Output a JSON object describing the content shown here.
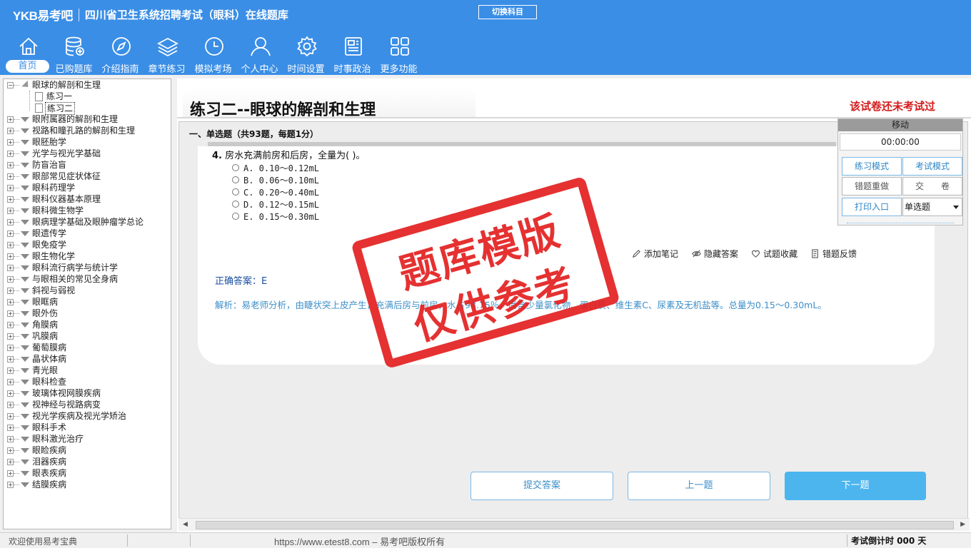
{
  "header": {
    "logo": "YKB易考吧",
    "title": "四川省卫生系统招聘考试（眼科）在线题库",
    "switch_label": "切换科目",
    "nav": [
      {
        "label": "首页",
        "icon": "home-icon",
        "active": true
      },
      {
        "label": "已购题库",
        "icon": "database-icon"
      },
      {
        "label": "介绍指南",
        "icon": "compass-icon"
      },
      {
        "label": "章节练习",
        "icon": "layers-icon"
      },
      {
        "label": "模拟考场",
        "icon": "clock-icon"
      },
      {
        "label": "个人中心",
        "icon": "user-icon"
      },
      {
        "label": "时间设置",
        "icon": "gear-icon"
      },
      {
        "label": "时事政治",
        "icon": "news-icon"
      },
      {
        "label": "更多功能",
        "icon": "grid-icon"
      }
    ]
  },
  "sidebar": {
    "root": "眼球的解剖和生理",
    "children": [
      "练习一",
      "练习二"
    ],
    "items": [
      "眼附属器的解剖和生理",
      "视路和瞳孔路的解剖和生理",
      "眼胚胎学",
      "光学与视光学基础",
      "防盲治盲",
      "眼部常见症状体征",
      "眼科药理学",
      "眼科仪器基本原理",
      "眼科微生物学",
      "眼病理学基础及眼肿瘤学总论",
      "眼遗传学",
      "眼免疫学",
      "眼生物化学",
      "眼科流行病学与统计学",
      "与眼相关的常见全身病",
      "斜视与弱视",
      "眼眶病",
      "眼外伤",
      "角膜病",
      "巩膜病",
      "葡萄膜病",
      "晶状体病",
      "青光眼",
      "眼科检查",
      "玻璃体视网膜疾病",
      "视神经与视路病变",
      "视光学疾病及视光学矫治",
      "眼科手术",
      "眼科激光治疗",
      "眼睑疾病",
      "泪器疾病",
      "眼表疾病",
      "结膜疾病"
    ]
  },
  "main": {
    "exam_title": "练习二--眼球的解剖和生理",
    "status": "该试卷还未考试过",
    "section": "一、单选题（共93题，每题1分）",
    "question_number": "4.",
    "question_text": "房水充满前房和后房，全量为( )。",
    "options": [
      "A. 0.10～0.12mL",
      "B. 0.06～0.10mL",
      "C. 0.20～0.40mL",
      "D. 0.12～0.15mL",
      "E. 0.15～0.30mL"
    ],
    "tools": [
      {
        "label": "添加笔记",
        "icon": "pencil-icon"
      },
      {
        "label": "隐藏答案",
        "icon": "eye-icon"
      },
      {
        "label": "试题收藏",
        "icon": "heart-icon"
      },
      {
        "label": "错题反馈",
        "icon": "report-icon"
      }
    ],
    "answer": "正确答案：E",
    "analysis": "解析：易老师分析，由睫状突上皮产生，充满后房与前房，水占98.75％，尚含少量氯化物、蛋白质、维生素C、尿素及无机盐等。总量为0.15～0.30mL。",
    "buttons": {
      "submit": "提交答案",
      "prev": "上一题",
      "next": "下一题"
    }
  },
  "panel": {
    "head": "移动",
    "timer": "00:00:00",
    "practice_mode": "练习模式",
    "exam_mode": "考试模式",
    "redo_wrong": "错题重做",
    "submit_paper": "交　　卷",
    "print": "打印入口",
    "type_select": "单选题"
  },
  "watermark": {
    "line1": "题库模版",
    "line2": "仅供参考"
  },
  "statusbar": {
    "welcome": "欢迎使用易考宝典",
    "url": "https://www.etest8.com – 易考吧版权所有",
    "countdown": "考试倒计时 000 天"
  },
  "colors": {
    "brand": "#3a8ee6",
    "alert": "#d21c1c",
    "answer": "#1a4fa0",
    "analysis": "#3d8fc8",
    "stamp": "#e32020"
  }
}
